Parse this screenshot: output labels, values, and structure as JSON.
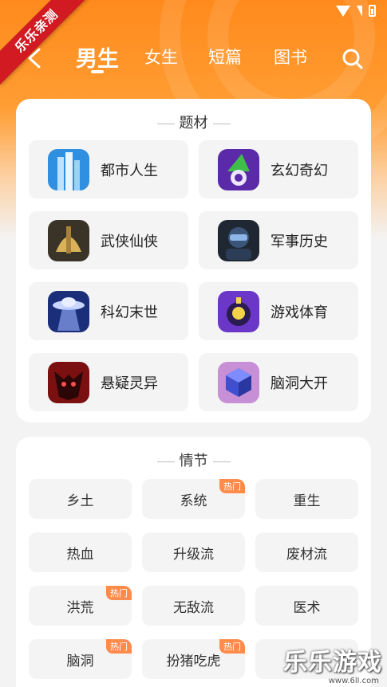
{
  "ribbon": "乐乐亲测",
  "nav": {
    "tabs": [
      "男生",
      "女生",
      "短篇",
      "图书"
    ],
    "active_index": 0
  },
  "theme": {
    "title": "题材",
    "items": [
      {
        "label": "都市人生",
        "icon": "city-buildings-icon"
      },
      {
        "label": "玄幻奇幻",
        "icon": "wizard-hat-icon"
      },
      {
        "label": "武侠仙侠",
        "icon": "warrior-helmet-icon"
      },
      {
        "label": "军事历史",
        "icon": "soldier-icon"
      },
      {
        "label": "科幻末世",
        "icon": "ufo-icon"
      },
      {
        "label": "游戏体育",
        "icon": "bomb-skull-icon"
      },
      {
        "label": "悬疑灵异",
        "icon": "demon-mask-icon"
      },
      {
        "label": "脑洞大开",
        "icon": "cube-icon"
      }
    ]
  },
  "plot": {
    "title": "情节",
    "hot_label": "热门",
    "items": [
      {
        "label": "乡土",
        "hot": false
      },
      {
        "label": "系统",
        "hot": true
      },
      {
        "label": "重生",
        "hot": false
      },
      {
        "label": "热血",
        "hot": false
      },
      {
        "label": "升级流",
        "hot": false
      },
      {
        "label": "废材流",
        "hot": false
      },
      {
        "label": "洪荒",
        "hot": true
      },
      {
        "label": "无敌流",
        "hot": false
      },
      {
        "label": "医术",
        "hot": false
      },
      {
        "label": "脑洞",
        "hot": true
      },
      {
        "label": "扮猪吃虎",
        "hot": true
      },
      {
        "label": "",
        "hot": false
      }
    ]
  },
  "watermark": {
    "text": "乐乐游戏",
    "url": "www.6ll.com"
  },
  "colors": {
    "accent": "#ff8a1c",
    "hot_badge": "#ff8b4a",
    "ribbon": "#d11a22"
  }
}
